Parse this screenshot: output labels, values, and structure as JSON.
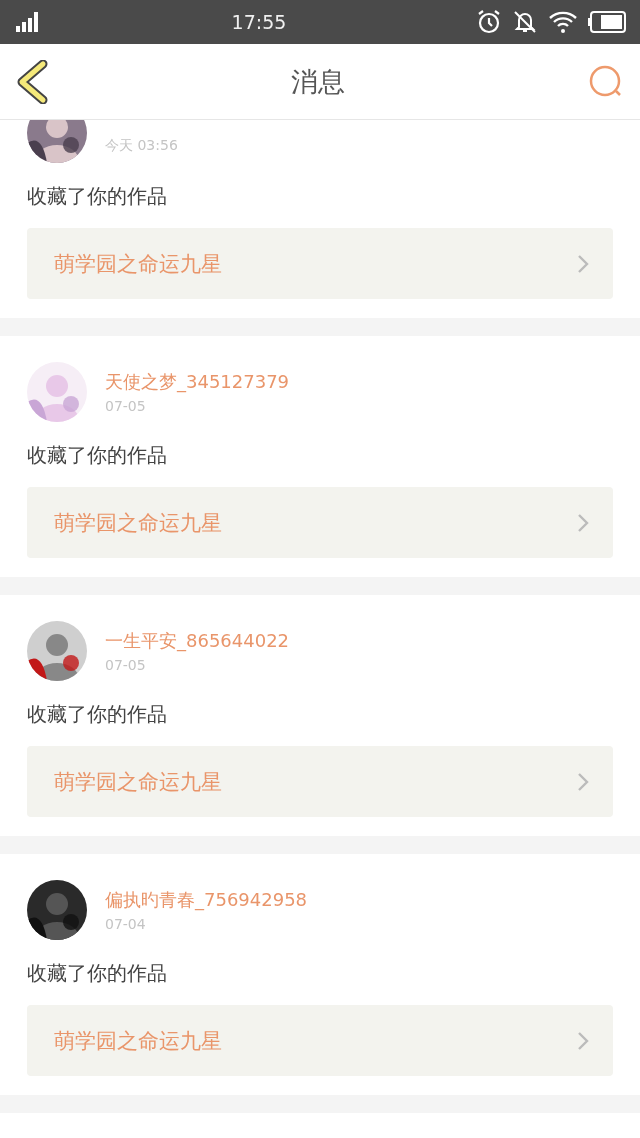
{
  "status_bar": {
    "time": "17:55"
  },
  "header": {
    "title": "消息"
  },
  "messages": [
    {
      "date": "今天 03:56",
      "action": "收藏了你的作品",
      "work": "萌学园之命运九星"
    },
    {
      "name": "天使之梦_345127379",
      "date": "07-05",
      "action": "收藏了你的作品",
      "work": "萌学园之命运九星"
    },
    {
      "name": "一生平安_865644022",
      "date": "07-05",
      "action": "收藏了你的作品",
      "work": "萌学园之命运九星"
    },
    {
      "name": "偏执旳青春_756942958",
      "date": "07-04",
      "action": "收藏了你的作品",
      "work": "萌学园之命运九星"
    }
  ]
}
